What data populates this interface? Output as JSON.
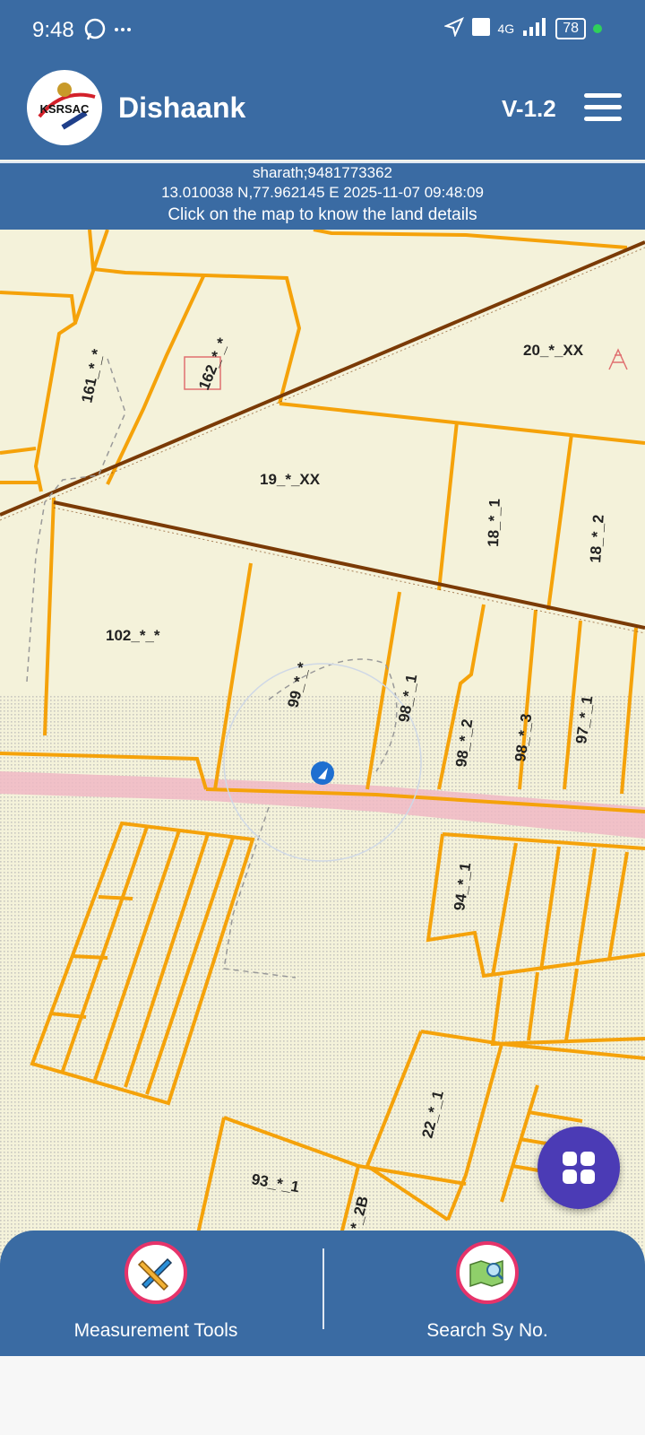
{
  "status_bar": {
    "time": "9:48",
    "left_icons": [
      "whatsapp-icon",
      "more-icon"
    ],
    "right_icons": [
      "location-arrow-icon",
      "volte-icon",
      "signal-4g-icon"
    ],
    "network": "4G",
    "battery": "78"
  },
  "header": {
    "logo_text": "KSRSAC",
    "title": "Dishaank",
    "version": "V-1.2"
  },
  "info": {
    "user": "sharath;9481773362",
    "coords_time": "13.010038 N,77.962145 E   2025-11-07 09:48:09",
    "hint": "Click on the map to know the land details"
  },
  "map": {
    "plot_labels": [
      "20_*_XX",
      "161_*_*",
      "162_*_*",
      "19_*_XX",
      "18_*_1",
      "18_*_2",
      "102_*_*",
      "99_*_*",
      "98_*_1",
      "98_*_2",
      "98_*_3",
      "97_*_1",
      "94_*_1",
      "22_*_1",
      "93_*_1",
      "*_2B"
    ],
    "colors": {
      "boundary": "#f5a20a",
      "road": "#7a3a06",
      "background": "#f4f2da",
      "path": "#f0b8c4"
    }
  },
  "bottom_bar": {
    "measurement_label": "Measurement Tools",
    "search_label": "Search Sy No."
  },
  "icons": {
    "fab": "grid-apps-icon",
    "measurement": "ruler-pencil-icon",
    "search": "map-search-icon",
    "menu": "hamburger-icon"
  }
}
